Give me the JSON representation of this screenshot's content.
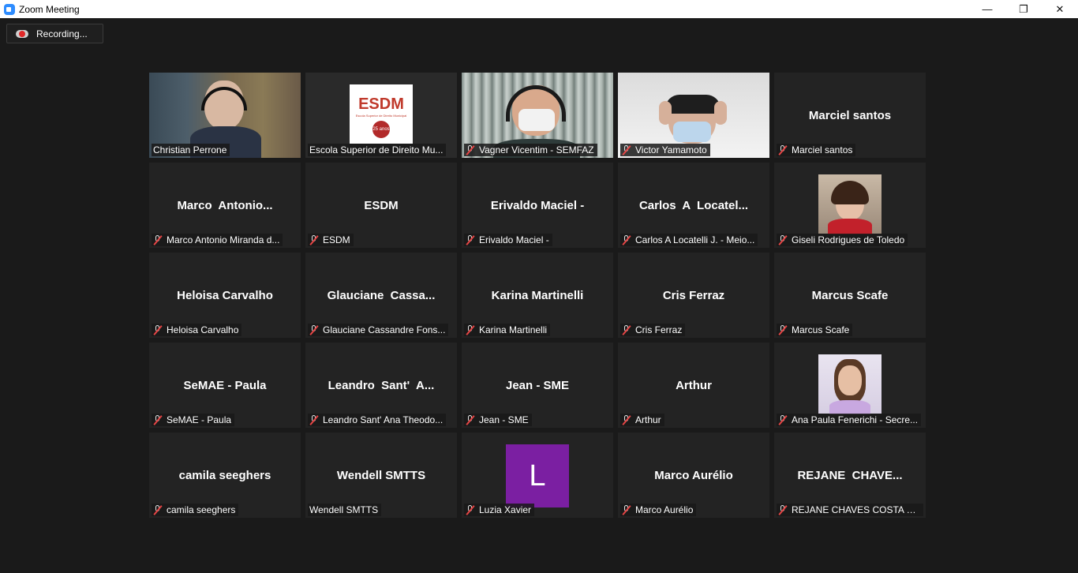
{
  "window": {
    "title": "Zoom Meeting"
  },
  "recording": {
    "label": "Recording..."
  },
  "participants": [
    {
      "name": "Christian Perrone",
      "display": "",
      "muted": false,
      "video": "christian"
    },
    {
      "name": "Escola Superior de Direito Mu...",
      "display": "",
      "muted": false,
      "video": "esdm"
    },
    {
      "name": "Vagner Vicentim - SEMFAZ",
      "display": "",
      "muted": true,
      "video": "vagner"
    },
    {
      "name": "Victor Yamamoto",
      "display": "",
      "muted": true,
      "video": "victor"
    },
    {
      "name": "Marciel santos",
      "display": "Marciel santos",
      "muted": true,
      "video": ""
    },
    {
      "name": "Marco Antonio Miranda d...",
      "display": "Marco  Antonio...",
      "muted": true,
      "video": ""
    },
    {
      "name": "ESDM",
      "display": "ESDM",
      "muted": true,
      "video": ""
    },
    {
      "name": "Erivaldo Maciel -",
      "display": "Erivaldo Maciel -",
      "muted": true,
      "video": ""
    },
    {
      "name": "Carlos A Locatelli J. - Meio...",
      "display": "Carlos  A  Locatel...",
      "muted": true,
      "video": ""
    },
    {
      "name": "Giseli Rodrigues de Toledo",
      "display": "",
      "muted": true,
      "video": "giseli"
    },
    {
      "name": "Heloisa Carvalho",
      "display": "Heloisa Carvalho",
      "muted": true,
      "video": ""
    },
    {
      "name": "Glauciane Cassandre Fons...",
      "display": "Glauciane  Cassa...",
      "muted": true,
      "video": ""
    },
    {
      "name": "Karina Martinelli",
      "display": "Karina Martinelli",
      "muted": true,
      "video": ""
    },
    {
      "name": "Cris Ferraz",
      "display": "Cris Ferraz",
      "muted": true,
      "video": ""
    },
    {
      "name": "Marcus Scafe",
      "display": "Marcus Scafe",
      "muted": true,
      "video": ""
    },
    {
      "name": "SeMAE - Paula",
      "display": "SeMAE - Paula",
      "muted": true,
      "video": ""
    },
    {
      "name": "Leandro Sant' Ana Theodo...",
      "display": "Leandro  Sant'  A...",
      "muted": true,
      "video": ""
    },
    {
      "name": "Jean - SME",
      "display": "Jean - SME",
      "muted": true,
      "video": ""
    },
    {
      "name": "Arthur",
      "display": "Arthur",
      "muted": true,
      "video": ""
    },
    {
      "name": "Ana Paula Fenerichi - Secre...",
      "display": "",
      "muted": true,
      "video": "ana"
    },
    {
      "name": "camila seeghers",
      "display": "camila seeghers",
      "muted": true,
      "video": ""
    },
    {
      "name": "Wendell SMTTS",
      "display": "Wendell SMTTS",
      "muted": false,
      "video": ""
    },
    {
      "name": "Luzia Xavier",
      "display": "",
      "muted": true,
      "video": "letter",
      "letter": "L"
    },
    {
      "name": "Marco Aurélio",
      "display": "Marco Aurélio",
      "muted": true,
      "video": ""
    },
    {
      "name": "REJANE CHAVES COSTA G...",
      "display": "REJANE  CHAVE...",
      "muted": true,
      "video": ""
    }
  ],
  "esdm_logo": {
    "text": "ESDM",
    "subtext": "Escola Superior de Direito Municipal",
    "badge": "25 anos"
  },
  "colors": {
    "active_border": "#e7e779",
    "avatar_purple": "#7b1fa2",
    "muted_red": "#e84545"
  }
}
